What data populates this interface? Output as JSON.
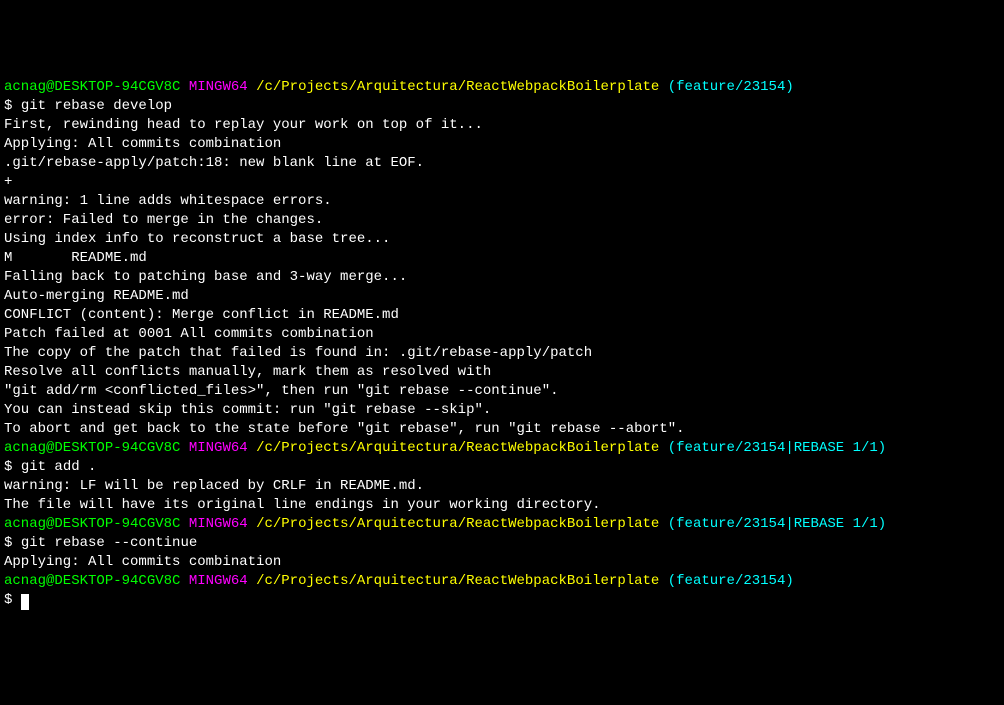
{
  "block1": {
    "prompt": {
      "user": "acnag@DESKTOP-94CGV8C",
      "mingw": "MINGW64",
      "path": "/c/Projects/Arquitectura/ReactWebpackBoilerplate",
      "branch": "(feature/23154)"
    },
    "cmd_prefix": "$ ",
    "cmd": "git rebase develop",
    "lines": [
      "First, rewinding head to replay your work on top of it...",
      "Applying: All commits combination",
      ".git/rebase-apply/patch:18: new blank line at EOF.",
      "+",
      "warning: 1 line adds whitespace errors.",
      "error: Failed to merge in the changes.",
      "Using index info to reconstruct a base tree...",
      "M       README.md",
      "Falling back to patching base and 3-way merge...",
      "Auto-merging README.md",
      "CONFLICT (content): Merge conflict in README.md",
      "Patch failed at 0001 All commits combination",
      "The copy of the patch that failed is found in: .git/rebase-apply/patch",
      "",
      "Resolve all conflicts manually, mark them as resolved with",
      "\"git add/rm <conflicted_files>\", then run \"git rebase --continue\".",
      "You can instead skip this commit: run \"git rebase --skip\".",
      "To abort and get back to the state before \"git rebase\", run \"git rebase --abort\".",
      ""
    ]
  },
  "block2": {
    "prompt": {
      "user": "acnag@DESKTOP-94CGV8C",
      "mingw": "MINGW64",
      "path": "/c/Projects/Arquitectura/ReactWebpackBoilerplate",
      "branch": "(feature/23154|REBASE 1/1)"
    },
    "cmd_prefix": "$ ",
    "cmd": "git add .",
    "lines": [
      "warning: LF will be replaced by CRLF in README.md.",
      "The file will have its original line endings in your working directory.",
      ""
    ]
  },
  "block3": {
    "prompt": {
      "user": "acnag@DESKTOP-94CGV8C",
      "mingw": "MINGW64",
      "path": "/c/Projects/Arquitectura/ReactWebpackBoilerplate",
      "branch": "(feature/23154|REBASE 1/1)"
    },
    "cmd_prefix": "$ ",
    "cmd": "git rebase --continue",
    "lines": [
      "Applying: All commits combination",
      ""
    ]
  },
  "block4": {
    "prompt": {
      "user": "acnag@DESKTOP-94CGV8C",
      "mingw": "MINGW64",
      "path": "/c/Projects/Arquitectura/ReactWebpackBoilerplate",
      "branch": "(feature/23154)"
    },
    "cmd_prefix": "$ "
  }
}
